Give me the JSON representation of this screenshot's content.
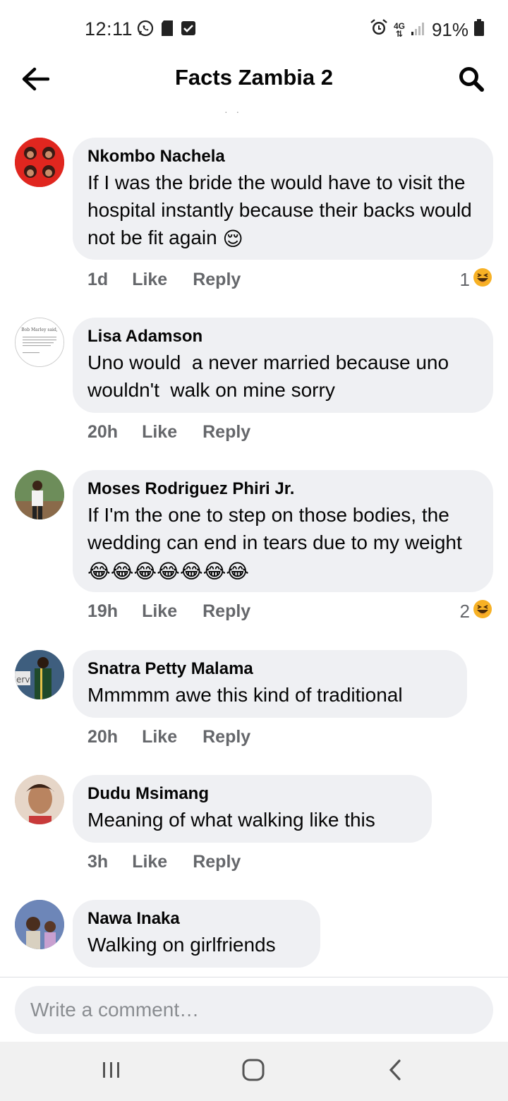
{
  "status_bar": {
    "time": "12:11",
    "battery": "91%",
    "network": "4G"
  },
  "header": {
    "title": "Facts Zambia 2",
    "back_icon": "arrow-left-icon",
    "search_icon": "search-icon"
  },
  "comments": [
    {
      "author": "Nkombo Nachela",
      "text": "If I was the bride the would have to visit the hospital instantly because their backs would not be fit again",
      "trailing_emoji": "😌",
      "time": "1d",
      "like": "Like",
      "reply": "Reply",
      "reaction_count": "1",
      "reaction_emoji": "haha"
    },
    {
      "author": "Lisa Adamson",
      "text": "Uno would  a never married because uno wouldn't  walk on mine sorry",
      "time": "20h",
      "like": "Like",
      "reply": "Reply"
    },
    {
      "author": "Moses Rodriguez Phiri Jr.",
      "text": "If I'm the one to step on those bodies, the wedding can end in tears due to my weight",
      "trailing_emoji": "😂😂😂😂😂😂😂",
      "time": "19h",
      "like": "Like",
      "reply": "Reply",
      "reaction_count": "2",
      "reaction_emoji": "haha"
    },
    {
      "author": "Snatra Petty Malama",
      "text": "Mmmmm awe this kind of traditional",
      "time": "20h",
      "like": "Like",
      "reply": "Reply"
    },
    {
      "author": "Dudu Msimang",
      "text": "Meaning of what walking like this",
      "time": "3h",
      "like": "Like",
      "reply": "Reply"
    },
    {
      "author": "Nawa Inaka",
      "text": "Walking on girlfriends"
    }
  ],
  "composer": {
    "placeholder": "Write a comment…"
  },
  "colors": {
    "bubble": "#eff0f3",
    "secondary_text": "#65676b",
    "haha_yellow": "#f7b125"
  }
}
